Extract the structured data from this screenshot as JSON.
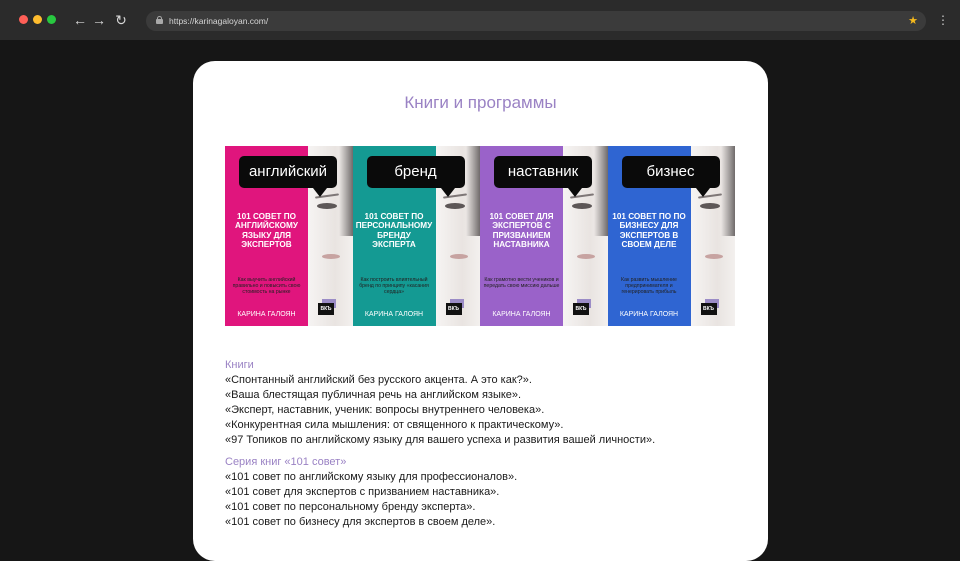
{
  "browser": {
    "url": "https://karinagaloyan.com/",
    "back_icon": "arrow-left-icon",
    "forward_icon": "arrow-right-icon",
    "reload_icon": "reload-icon",
    "star_icon": "star-icon",
    "menu_icon": "more-vertical-icon"
  },
  "page": {
    "title": "Книги и программы",
    "books": [
      {
        "bubble": "английский",
        "cover_title": "101 СОВЕТ ПО АНГЛИЙСКОМУ ЯЗЫКУ ДЛЯ ЭКСПЕРТОВ",
        "cover_subtitle": "Как выучить английский правильно и повысить свою стоимость на рынке",
        "author": "КАРИНА ГАЛОЯН",
        "publisher": "ВКЪ",
        "color": "#e0157d"
      },
      {
        "bubble": "бренд",
        "cover_title": "101 СОВЕТ ПО ПЕРСОНАЛЬНОМУ БРЕНДУ ЭКСПЕРТА",
        "cover_subtitle": "Как построить влиятельный бренд по принципу «касания сердца»",
        "author": "КАРИНА ГАЛОЯН",
        "publisher": "ВКЪ",
        "color": "#149a93"
      },
      {
        "bubble": "наставник",
        "cover_title": "101 СОВЕТ ДЛЯ ЭКСПЕРТОВ С ПРИЗВАНИЕМ НАСТАВНИКА",
        "cover_subtitle": "Как грамотно вести учеников и передать свою миссию дальше",
        "author": "КАРИНА ГАЛОЯН",
        "publisher": "ВКЪ",
        "color": "#9a62c9"
      },
      {
        "bubble": "бизнес",
        "cover_title": "101 СОВЕТ ПО ПО БИЗНЕСУ ДЛЯ ЭКСПЕРТОВ В СВОЕМ ДЕЛЕ",
        "cover_subtitle": "Как развить мышление предпринимателя и генерировать прибыль",
        "author": "КАРИНА ГАЛОЯН",
        "publisher": "ВКЪ",
        "color": "#2f65d2"
      }
    ],
    "books_section": {
      "heading": "Книги",
      "items": [
        "«Спонтанный английский без русского акцента. А это как?».",
        "«Ваша блестящая публичная речь на английском языке».",
        "«Эксперт, наставник, ученик: вопросы внутреннего человека».",
        "«Конкурентная сила мышления: от священного к практическому».",
        "«97 Топиков по английскому языку для вашего успеха и развития вашей личности»."
      ]
    },
    "series_section": {
      "heading": "Серия книг «101 совет»",
      "items": [
        "«101 совет по английскому языку для профессионалов».",
        "«101 совет для экспертов с призванием наставника».",
        "«101 совет по персональному бренду эксперта».",
        "«101 совет по бизнесу для экспертов в своем деле»."
      ]
    }
  }
}
